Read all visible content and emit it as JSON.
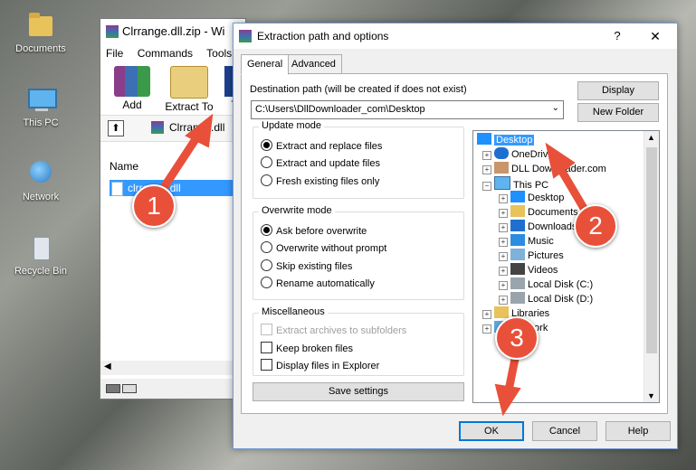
{
  "desktop": {
    "icons": [
      {
        "label": "Documents",
        "icon": "documents-icon"
      },
      {
        "label": "This PC",
        "icon": "computer-icon"
      },
      {
        "label": "Network",
        "icon": "network-icon"
      },
      {
        "label": "Recycle Bin",
        "icon": "recycle-bin-icon"
      }
    ]
  },
  "winrar": {
    "title": "Clrrange.dll.zip - Wi",
    "menu": [
      "File",
      "Commands",
      "Tools"
    ],
    "toolbar": {
      "add": "Add",
      "extract_to": "Extract To",
      "partial": "T"
    },
    "path": "Clrrange.dll",
    "list_header": "Name",
    "file": "clrrange.dll"
  },
  "dialog": {
    "title": "Extraction path and options",
    "help": "?",
    "close": "✕",
    "tabs": [
      "General",
      "Advanced"
    ],
    "dest_label": "Destination path (will be created if does not exist)",
    "dest_value": "C:\\Users\\DllDownloader_com\\Desktop",
    "display_btn": "Display",
    "new_folder_btn": "New Folder",
    "update_mode": {
      "title": "Update mode",
      "options": [
        "Extract and replace files",
        "Extract and update files",
        "Fresh existing files only"
      ]
    },
    "overwrite_mode": {
      "title": "Overwrite mode",
      "options": [
        "Ask before overwrite",
        "Overwrite without prompt",
        "Skip existing files",
        "Rename automatically"
      ]
    },
    "misc": {
      "title": "Miscellaneous",
      "options": [
        "Extract archives to subfolders",
        "Keep broken files",
        "Display files in Explorer"
      ]
    },
    "save_settings": "Save settings",
    "tree": [
      "Desktop",
      "OneDrive",
      "DLL Downloader.com",
      "This PC",
      "Desktop",
      "Documents",
      "Downloads",
      "Music",
      "Pictures",
      "Videos",
      "Local Disk (C:)",
      "Local Disk (D:)",
      "Libraries",
      "Network"
    ],
    "ok": "OK",
    "cancel": "Cancel",
    "help_btn": "Help"
  },
  "annotations": [
    "1",
    "2",
    "3"
  ],
  "colors": {
    "accent": "#0078d7",
    "annotation": "#e8503a",
    "selection": "#3399ff"
  }
}
